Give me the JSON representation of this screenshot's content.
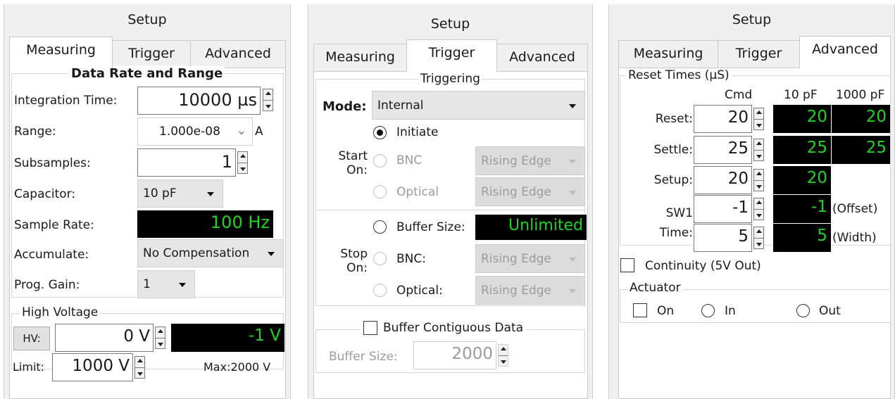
{
  "panel1": {
    "title": "Setup",
    "tabs": [
      "Measuring",
      "Trigger",
      "Advanced"
    ],
    "group_title": "Data Rate and Range",
    "integration_time_label": "Integration Time:",
    "integration_time_value": "10000 µs",
    "range_label": "Range:",
    "range_value": "1.000e-08",
    "range_unit": "A",
    "subsamples_label": "Subsamples:",
    "subsamples_value": "1",
    "capacitor_label": "Capacitor:",
    "capacitor_value": "10 pF",
    "sample_rate_label": "Sample Rate:",
    "sample_rate_value": "100 Hz",
    "accumulate_label": "Accumulate:",
    "accumulate_value": "No Compensation",
    "prog_gain_label": "Prog. Gain:",
    "prog_gain_value": "1",
    "hv_group_title": "High Voltage",
    "hv_button": "HV:",
    "hv_value": "0 V",
    "hv_readout": "-1 V",
    "limit_label": "Limit:",
    "limit_value": "1000 V",
    "max_text": "Max:2000 V"
  },
  "panel2": {
    "title": "Setup",
    "tabs": [
      "Measuring",
      "Trigger",
      "Advanced"
    ],
    "group_title": "Triggering",
    "mode_label": "Mode:",
    "mode_value": "Internal",
    "start_on_label_1": "Start",
    "start_on_label_2": "On:",
    "initiate_label": "Initiate",
    "bnc_label": "BNC",
    "optical_label": "Optical",
    "rising_edge": "Rising Edge",
    "buffer_size_label": "Buffer Size:",
    "buffer_size_value": "Unlimited",
    "stop_on_label_1": "Stop",
    "stop_on_label_2": "On:",
    "stop_bnc_label": "BNC:",
    "stop_optical_label": "Optical:",
    "buffer_contiguous_label": "Buffer Contiguous Data",
    "buffer_size2_label": "Buffer Size:",
    "buffer_size2_value": "2000"
  },
  "panel3": {
    "title": "Setup",
    "tabs": [
      "Measuring",
      "Trigger",
      "Advanced"
    ],
    "group_title": "Reset Times (µS)",
    "col_cmd": "Cmd",
    "col_10pf": "10 pF",
    "col_1000pf": "1000 pF",
    "rows": [
      {
        "label": "Reset:",
        "cmd": "20",
        "v10": "20",
        "v1000": "20"
      },
      {
        "label": "Settle:",
        "cmd": "25",
        "v10": "25",
        "v1000": "25"
      },
      {
        "label": "Setup:",
        "cmd": "20",
        "v10": "20"
      },
      {
        "label": "",
        "cmd": "-1",
        "v10": "-1",
        "note": "(Offset)"
      },
      {
        "label": "Time:",
        "cmd": "5",
        "v10": "5",
        "note": "(Width)"
      }
    ],
    "sw1_label": "SW1",
    "continuity_label": "Continuity (5V Out)",
    "actuator_title": "Actuator",
    "act_on": "On",
    "act_in": "In",
    "act_out": "Out"
  }
}
